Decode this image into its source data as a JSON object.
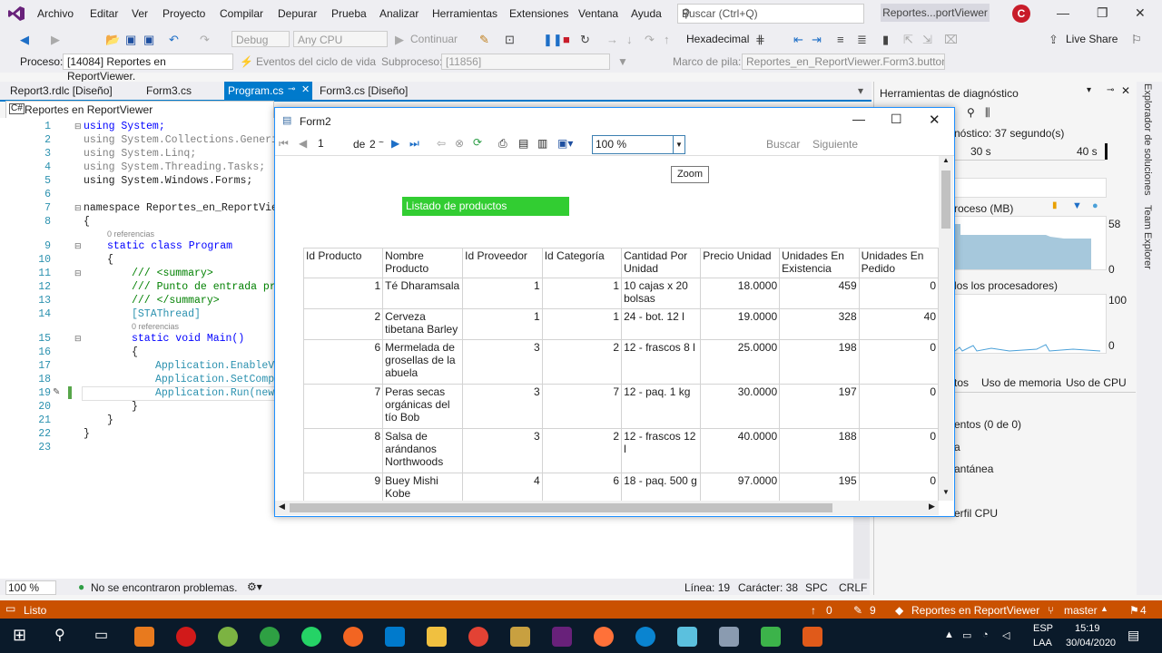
{
  "menu": [
    "Archivo",
    "Editar",
    "Ver",
    "Proyecto",
    "Compilar",
    "Depurar",
    "Prueba",
    "Analizar",
    "Herramientas",
    "Extensiones",
    "Ventana",
    "Ayuda"
  ],
  "search_placeholder": "Buscar (Ctrl+Q)",
  "solution_button": "Reportes...portViewer",
  "avatar_initial": "C",
  "toolbar": {
    "config": "Debug",
    "platform": "Any CPU",
    "continue": "Continuar",
    "hexadecimal": "Hexadecimal",
    "live_share": "Live Share"
  },
  "process_bar": {
    "process_label": "Proceso:",
    "process_value": "[14084] Reportes en ReportViewer.",
    "events": "Eventos del ciclo de vida",
    "subprocess_label": "Subproceso:",
    "subprocess_value": "[11856]",
    "stack_label": "Marco de pila:",
    "stack_value": "Reportes_en_ReportViewer.Form3.button1"
  },
  "tabs": [
    "Report3.rdlc [Diseño]",
    "Form3.cs",
    "Program.cs",
    "Form3.cs [Diseño]"
  ],
  "nav_project": "Reportes en ReportViewer",
  "code": {
    "lines": [
      "1",
      "2",
      "3",
      "4",
      "5",
      "6",
      "7",
      "8",
      "",
      "9",
      "10",
      "11",
      "12",
      "13",
      "14",
      "",
      "15",
      "16",
      "17",
      "18",
      "19",
      "20",
      "21",
      "22",
      "23"
    ],
    "refs": "0 referencias",
    "l1": "using System;",
    "l2": "using System.Collections.Generic",
    "l3": "using System.Linq;",
    "l4": "using System.Threading.Tasks;",
    "l5": "using System.Windows.Forms;",
    "l7": "namespace Reportes_en_ReportView",
    "l8": "{",
    "l9": "static class Program",
    "l10": "{",
    "l11": "/// <summary>",
    "l12": "/// Punto de entrada pri",
    "l13": "/// </summary>",
    "l14": "[STAThread]",
    "l15": "static void Main()",
    "l16": "{",
    "l17": "Application.EnableVi",
    "l18": "Application.SetCompa",
    "l19": "Application.Run(new",
    "l20": "}",
    "l21": "}",
    "l22": "}"
  },
  "editor_status": {
    "zoom": "100 %",
    "problems": "No se encontraron problemas.",
    "line": "Línea: 19",
    "char": "Carácter: 38",
    "spc": "SPC",
    "crlf": "CRLF"
  },
  "status_bar": {
    "ready": "Listo",
    "up": "0",
    "edits": "9",
    "project": "Reportes en ReportViewer",
    "branch": "master",
    "notif": "4"
  },
  "diag": {
    "title": "Herramientas de diagnóstico",
    "session": "nóstico: 37 segundo(s)",
    "t30": "30 s",
    "t40": "40 s",
    "memory": "roceso (MB)",
    "mem_hi": "58",
    "mem_lo": "0",
    "cpu": "los los procesadores)",
    "cpu_hi": "100",
    "cpu_lo": "0",
    "tab_events": "tos",
    "tab_memory": "Uso de memoria",
    "tab_cpu": "Uso de CPU",
    "events_count": "entos (0 de 0)",
    "row_a": "a",
    "snapshot": "antánea",
    "cpu_profile": "erfil CPU",
    "side1": "Explorador de soluciones",
    "side2": "Team Explorer"
  },
  "form2": {
    "title": "Form2",
    "page": "1",
    "of": "de",
    "pages": "2",
    "zoom": "100 %",
    "find": "Buscar",
    "next": "Siguiente",
    "tooltip": "Zoom",
    "report_title": "Listado de productos",
    "headers": [
      "Id Producto",
      "Nombre Producto",
      "Id Proveedor",
      "Id Categoría",
      "Cantidad Por Unidad",
      "Precio Unidad",
      "Unidades En Existencia",
      "Unidades En Pedido"
    ],
    "rows": [
      [
        "1",
        "Té Dharamsala",
        "1",
        "1",
        "10 cajas x 20 bolsas",
        "18.0000",
        "459",
        "0"
      ],
      [
        "2",
        "Cerveza tibetana Barley",
        "1",
        "1",
        "24 - bot. 12 l",
        "19.0000",
        "328",
        "40"
      ],
      [
        "6",
        "Mermelada de grosellas de la abuela",
        "3",
        "2",
        "12 - frascos 8 l",
        "25.0000",
        "198",
        "0"
      ],
      [
        "7",
        "Peras secas orgánicas del tío Bob",
        "3",
        "7",
        "12 - paq. 1 kg",
        "30.0000",
        "197",
        "0"
      ],
      [
        "8",
        "Salsa de arándanos Northwoods",
        "3",
        "2",
        "12 - frascos 12 l",
        "40.0000",
        "188",
        "0"
      ],
      [
        "9",
        "Buey Mishi Kobe",
        "4",
        "6",
        "18 - paq. 500 g",
        "97.0000",
        "195",
        "0"
      ]
    ]
  },
  "taskbar": {
    "lang": "ESP",
    "lang2": "LAA",
    "time": "15:19",
    "date": "30/04/2020"
  }
}
